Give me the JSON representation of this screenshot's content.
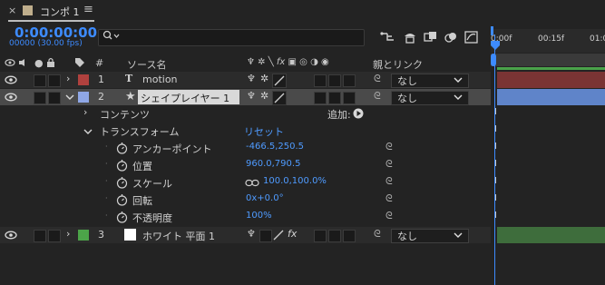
{
  "tab": {
    "close": "×",
    "title": "コンポ 1",
    "menu": "≡"
  },
  "header": {
    "timecode": "0:00:00:00",
    "fps": "00000 (30.00 fps)",
    "search_placeholder": ""
  },
  "columns": {
    "hash": "#",
    "source_name": "ソース名",
    "parent": "親とリンク"
  },
  "layers": [
    {
      "num": "1",
      "name": "motion",
      "label_color": "#b0413e",
      "parent": "なし",
      "bar_color": "#7a3434"
    },
    {
      "num": "2",
      "name": "シェイプレイヤー 1",
      "label_color": "#8fa7e6",
      "parent": "なし",
      "bar_color": "#5f84c9"
    },
    {
      "num": "3",
      "name": "ホワイト 平面 1",
      "label_color": "#4ca449",
      "parent": "なし",
      "bar_color": "#3e6d3c"
    }
  ],
  "contents": {
    "label": "コンテンツ",
    "add_label": "追加:"
  },
  "transform": {
    "label": "トランスフォーム",
    "reset": "リセット"
  },
  "properties": [
    {
      "name": "アンカーポイント",
      "value": "-466.5,250.5"
    },
    {
      "name": "位置",
      "value": "960.0,790.5"
    },
    {
      "name": "スケール",
      "value": "100.0,100.0%"
    },
    {
      "name": "回転",
      "value": "0x+0.0°"
    },
    {
      "name": "不透明度",
      "value": "100%"
    }
  ],
  "ruler": {
    "t0": "0:00f",
    "t1": "00:15f",
    "t2": "01:0"
  },
  "colors": {
    "accent": "#3d8bff"
  }
}
